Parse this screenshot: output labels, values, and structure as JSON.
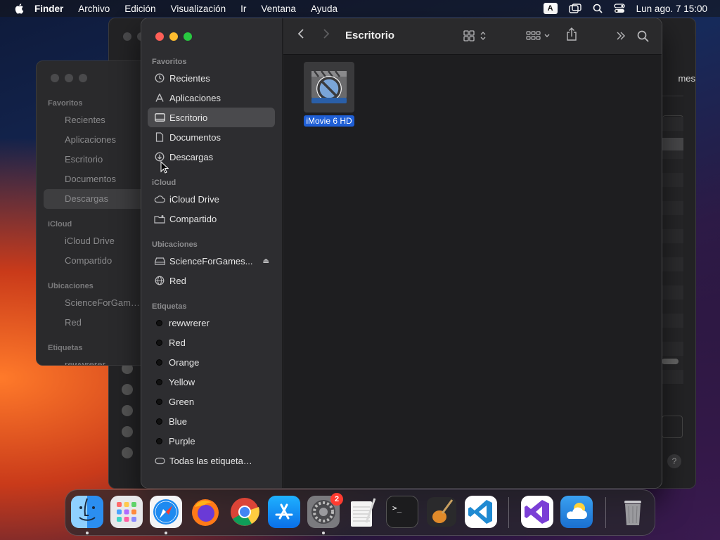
{
  "menubar": {
    "app": "Finder",
    "items": [
      "Archivo",
      "Edición",
      "Visualización",
      "Ir",
      "Ventana",
      "Ayuda"
    ],
    "input_source": "A",
    "datetime": "Lun ago. 7  15:00"
  },
  "background": {
    "back_window_partial_text": "mes",
    "mid_window": {
      "sections": [
        "Favoritos",
        "iCloud",
        "Ubicaciones",
        "Etiquetas"
      ],
      "items": [
        "Recientes",
        "Aplicaciones",
        "Escritorio",
        "Documentos",
        "Descargas",
        "iCloud Drive",
        "Compartido",
        "ScienceForGam…",
        "Red",
        "rewwrerer"
      ]
    }
  },
  "finder": {
    "title": "Escritorio",
    "sidebar": {
      "sections": {
        "favoritos": "Favoritos",
        "icloud": "iCloud",
        "ubicaciones": "Ubicaciones",
        "etiquetas": "Etiquetas"
      },
      "favoritos": [
        {
          "label": "Recientes",
          "icon": "clock-icon"
        },
        {
          "label": "Aplicaciones",
          "icon": "applications-icon"
        },
        {
          "label": "Escritorio",
          "icon": "desktop-icon",
          "selected": true
        },
        {
          "label": "Documentos",
          "icon": "document-icon"
        },
        {
          "label": "Descargas",
          "icon": "download-icon"
        }
      ],
      "icloud": [
        {
          "label": "iCloud Drive",
          "icon": "cloud-icon"
        },
        {
          "label": "Compartido",
          "icon": "shared-folder-icon"
        }
      ],
      "ubicaciones": [
        {
          "label": "ScienceForGames...",
          "icon": "drive-icon"
        },
        {
          "label": "Red",
          "icon": "network-icon"
        }
      ],
      "etiquetas": [
        {
          "label": "rewwrerer",
          "color": "#111111"
        },
        {
          "label": "Red",
          "color": "#111111"
        },
        {
          "label": "Orange",
          "color": "#111111"
        },
        {
          "label": "Yellow",
          "color": "#111111"
        },
        {
          "label": "Green",
          "color": "#111111"
        },
        {
          "label": "Blue",
          "color": "#111111"
        },
        {
          "label": "Purple",
          "color": "#111111"
        },
        {
          "label": "Todas las etiquetas...",
          "icon": "all-tags-icon"
        }
      ]
    },
    "files": [
      {
        "name": "iMovie 6 HD",
        "icon": "imovie-prohibited-icon",
        "selected": true
      }
    ]
  },
  "dock": {
    "apps": [
      {
        "name": "Finder",
        "icon": "finder-icon",
        "running": true
      },
      {
        "name": "Launchpad",
        "icon": "launchpad-icon",
        "running": false
      },
      {
        "name": "Safari",
        "icon": "safari-icon",
        "running": true
      },
      {
        "name": "Firefox",
        "icon": "firefox-icon",
        "running": false
      },
      {
        "name": "Chrome",
        "icon": "chrome-icon",
        "running": false
      },
      {
        "name": "App Store",
        "icon": "app-store-icon",
        "running": false
      },
      {
        "name": "Preferencias del Sistema",
        "icon": "system-preferences-icon",
        "running": true,
        "badge": "2"
      },
      {
        "name": "TextEdit",
        "icon": "textedit-icon",
        "running": false
      },
      {
        "name": "Terminal",
        "icon": "terminal-icon",
        "running": false
      },
      {
        "name": "GarageBand",
        "icon": "garageband-icon",
        "running": false
      },
      {
        "name": "Visual Studio Code",
        "icon": "vscode-icon",
        "running": false
      },
      {
        "name": "Visual Studio",
        "icon": "visual-studio-icon",
        "running": false
      },
      {
        "name": "Weather",
        "icon": "weather-icon",
        "running": false
      },
      {
        "name": "Papelera",
        "icon": "trash-icon",
        "running": false
      }
    ]
  }
}
